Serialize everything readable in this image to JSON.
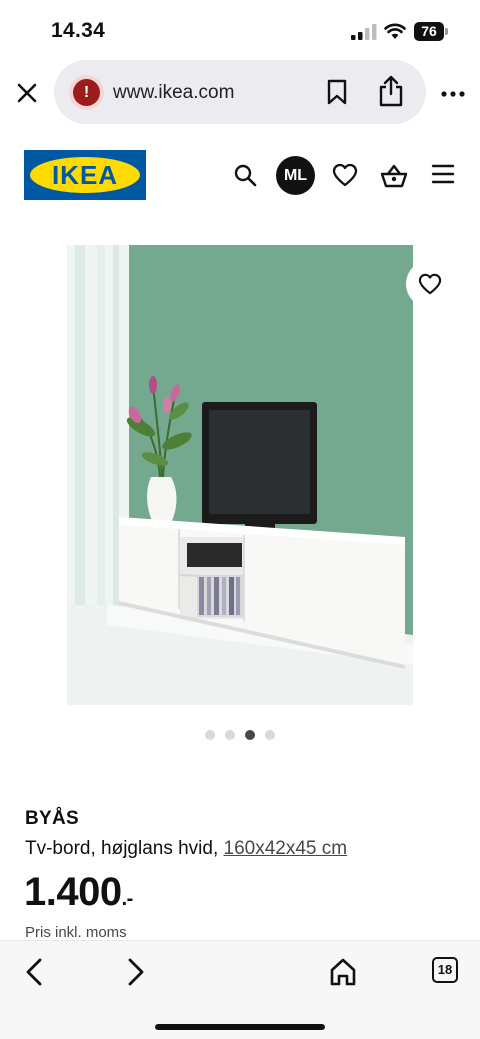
{
  "status_bar": {
    "time": "14.34",
    "battery_level": "76",
    "signal_icon": "cellular-signal-icon",
    "wifi_icon": "wifi-icon"
  },
  "browser": {
    "url": "www.ikea.com",
    "tab_count": "18",
    "icons": [
      "close-icon",
      "site-warning-icon",
      "bookmark-icon",
      "share-icon",
      "more-icon",
      "back-icon",
      "forward-icon",
      "home-icon",
      "tabs-icon"
    ]
  },
  "header": {
    "logo_text": "IKEA",
    "avatar_initials": "ML",
    "colors": {
      "brand_blue": "#0058a3",
      "brand_yellow": "#ffdb00"
    }
  },
  "gallery": {
    "image_count": 4,
    "active_index": 2
  },
  "product": {
    "name": "BYÅS",
    "description": "Tv-bord, højglans hvid, ",
    "dimensions": "160x42x45 cm",
    "price_main": "1.400",
    "price_suffix": ".-",
    "price_note": "Pris inkl. moms"
  }
}
